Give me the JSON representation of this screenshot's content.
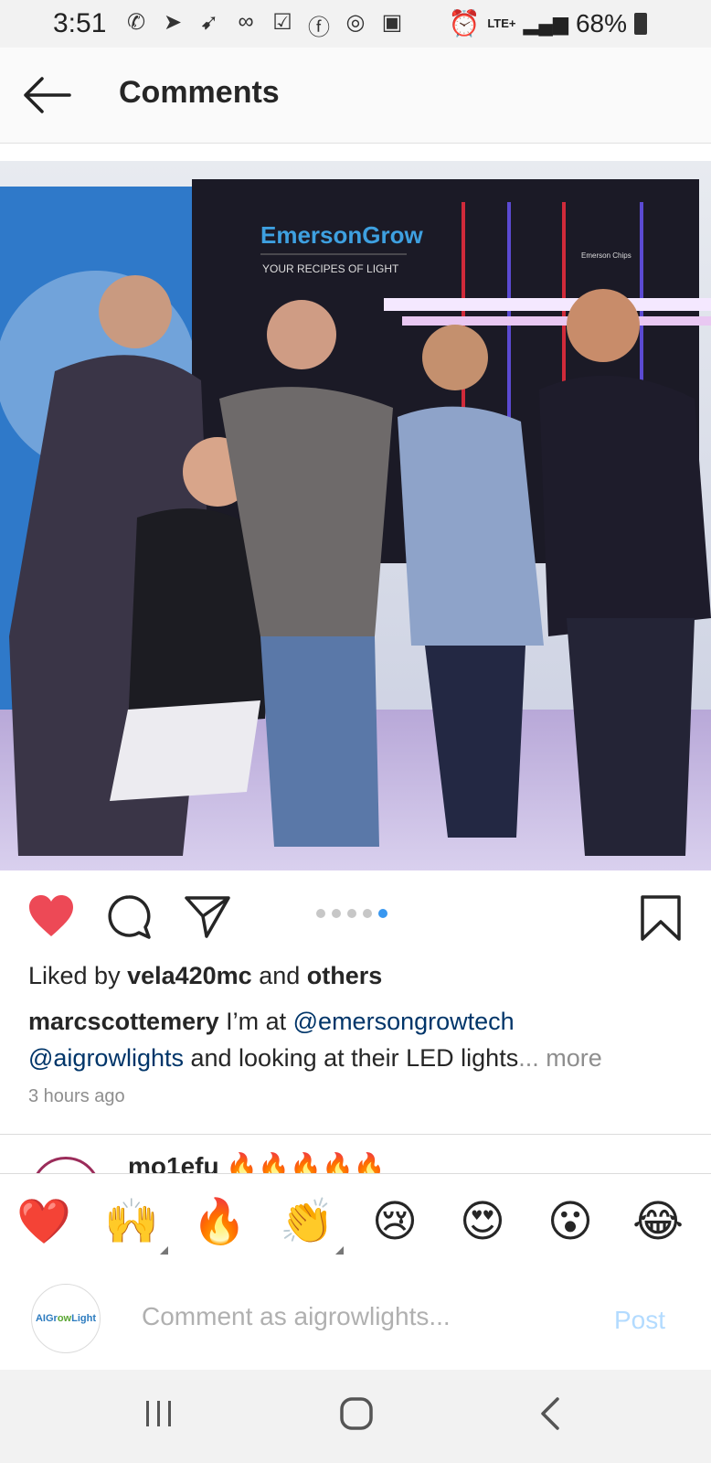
{
  "status_bar": {
    "time": "3:51",
    "network": "LTE+",
    "battery": "68%",
    "icons": [
      "whatsapp-icon",
      "telegram-icon",
      "send-icon",
      "voicemail-icon",
      "checkbox-icon",
      "facebook-icon",
      "instagram-icon",
      "linkedin-icon",
      "alarm-icon",
      "signal-icon",
      "battery-icon"
    ]
  },
  "header": {
    "back_icon": "arrow-left-icon",
    "title": "Comments"
  },
  "post": {
    "photo": {
      "brand": "EmersonGrow",
      "tagline": "YOUR RECIPES OF LIGHT",
      "side_label": "Emerson Chips"
    },
    "carousel": {
      "count": 5,
      "active_index": 4
    },
    "likes": {
      "prefix": "Liked by ",
      "user": "vela420mc",
      "middle": " and ",
      "others": "others"
    },
    "caption": {
      "user": "marcscottemery",
      "text1": " I’m at ",
      "mention1": "@emersongrowtech",
      "mention2": "@aigrowlights",
      "text2": " and looking at their LED lights",
      "more": "... more"
    },
    "time_ago": "3 hours ago"
  },
  "next_comment_peek": {
    "text": "mo1efu 🔥🔥🔥🔥🔥"
  },
  "emoji_bar": [
    "❤️",
    "🙌",
    "🔥",
    "👏",
    "😢",
    "😍",
    "😮",
    "😂"
  ],
  "composer": {
    "avatar_brand_a": "AIGr",
    "avatar_brand_b": "ow",
    "avatar_brand_c": "Light",
    "placeholder": "Comment as aigrowlights...",
    "post_label": "Post"
  },
  "colors": {
    "heart": "#ed4956",
    "mention": "#003569",
    "dot_active": "#3897f0",
    "post_disabled": "#b3dbff"
  }
}
